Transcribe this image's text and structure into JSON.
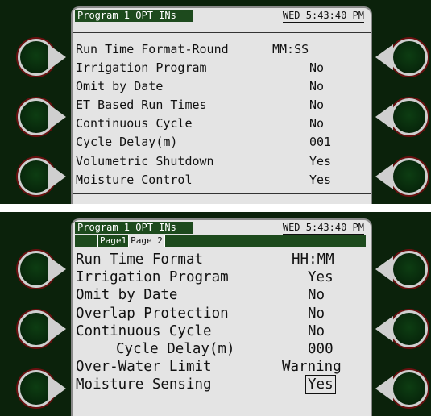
{
  "panel1": {
    "title": "Program 1 OPT INs",
    "clock": "WED 5:43:40 PM",
    "rows": [
      {
        "label": "Run Time Format-Round",
        "value": "MM:SS"
      },
      {
        "label": "Irrigation Program",
        "value": "No"
      },
      {
        "label": "Omit by Date",
        "value": "No"
      },
      {
        "label": "ET Based Run Times",
        "value": "No"
      },
      {
        "label": "Continuous Cycle",
        "value": "No"
      },
      {
        "label": "Cycle Delay(m)",
        "value": "001"
      },
      {
        "label": "Volumetric Shutdown",
        "value": "Yes"
      },
      {
        "label": "Moisture Control",
        "value": "Yes"
      }
    ]
  },
  "panel2": {
    "title": "Program 1 OPT INs",
    "clock": "WED 5:43:40 PM",
    "tabs": [
      "Page1",
      "Page 2"
    ],
    "rows": [
      {
        "label": "Run Time Format",
        "value": "HH:MM"
      },
      {
        "label": "Irrigation Program",
        "value": "Yes"
      },
      {
        "label": "Omit by Date",
        "value": "No"
      },
      {
        "label": "Overlap Protection",
        "value": "No"
      },
      {
        "label": "Continuous Cycle",
        "value": "No"
      },
      {
        "label": "Cycle Delay(m)",
        "value": "000"
      },
      {
        "label": "Over-Water Limit",
        "value": "Warning"
      },
      {
        "label": "Moisture Sensing",
        "value": "Yes"
      }
    ]
  },
  "colors": {
    "bezel": "#0b220b",
    "screen": "#e4e4e4",
    "header_bar": "#1d4a1d"
  },
  "icons": [
    "softkey-button-left",
    "softkey-button-right"
  ]
}
